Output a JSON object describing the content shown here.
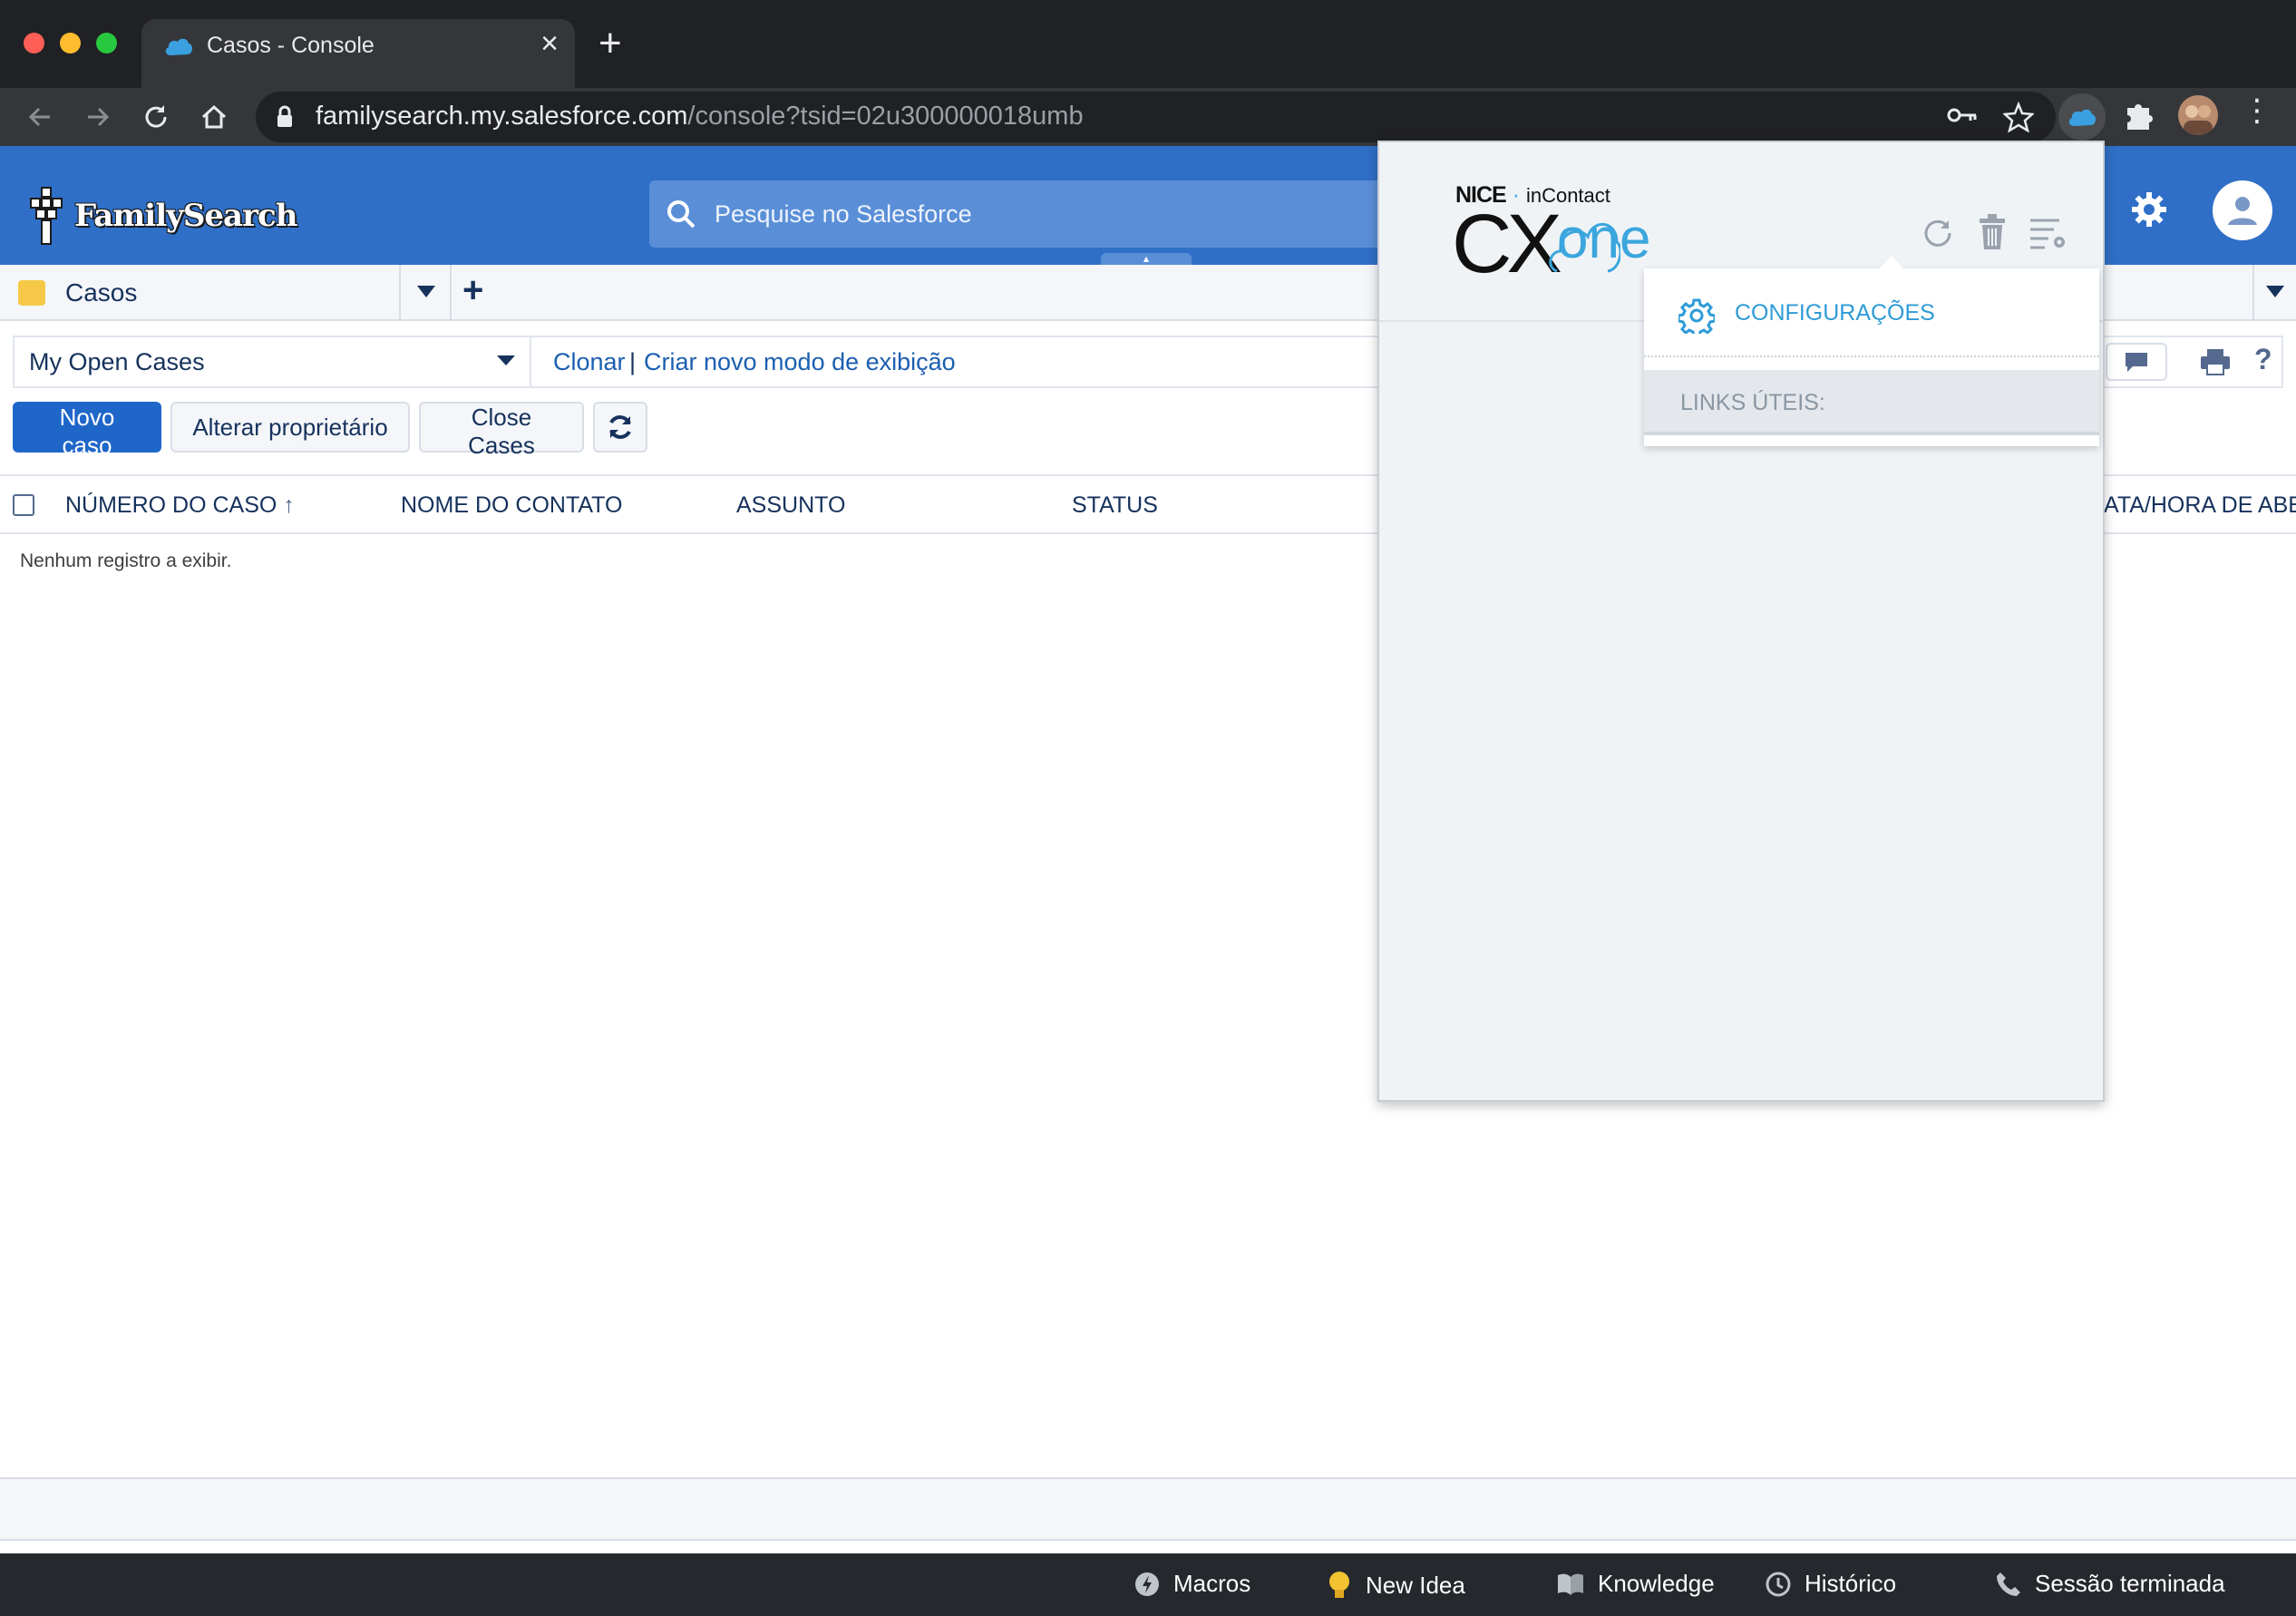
{
  "browser": {
    "tab_title": "Casos - Console",
    "url_host": "familysearch.my.salesforce.com",
    "url_path": "/console?tsid=02u300000018umb"
  },
  "header": {
    "logo_text": "FamilySearch",
    "search_placeholder": "Pesquise no Salesforce",
    "brand_color": "#2f6fc7"
  },
  "tabs": {
    "primary_label": "Casos"
  },
  "listview": {
    "selected_view": "My Open Cases",
    "clone_link": "Clonar",
    "separator": "|",
    "new_view_link": "Criar novo modo de exibição"
  },
  "actions": {
    "new_case": "Novo caso",
    "change_owner": "Alterar proprietário",
    "close_cases": "Close Cases"
  },
  "grid": {
    "columns": [
      {
        "label": "NÚMERO DO CASO",
        "sorted": "asc"
      },
      {
        "label": "NOME DO CONTATO"
      },
      {
        "label": "ASSUNTO"
      },
      {
        "label": "STATUS"
      },
      {
        "label": "ATA/HORA DE ABE"
      }
    ],
    "empty_message": "Nenhum registro a exibir."
  },
  "footer": {
    "items": [
      {
        "label": "Macros",
        "icon": "macros-icon"
      },
      {
        "label": "New Idea",
        "icon": "lightbulb-icon"
      },
      {
        "label": "Knowledge",
        "icon": "book-icon"
      },
      {
        "label": "Histórico",
        "icon": "clock-icon"
      },
      {
        "label": "Sessão terminada",
        "icon": "phone-icon"
      }
    ]
  },
  "cxone": {
    "logo_nice": "NICE",
    "logo_incontact": "inContact",
    "logo_cx": "CX",
    "logo_one": "one",
    "menu": {
      "settings_label": "CONFIGURAÇÕES",
      "links_label": "LINKS ÚTEIS:"
    },
    "accent_color": "#2f9bd6"
  }
}
